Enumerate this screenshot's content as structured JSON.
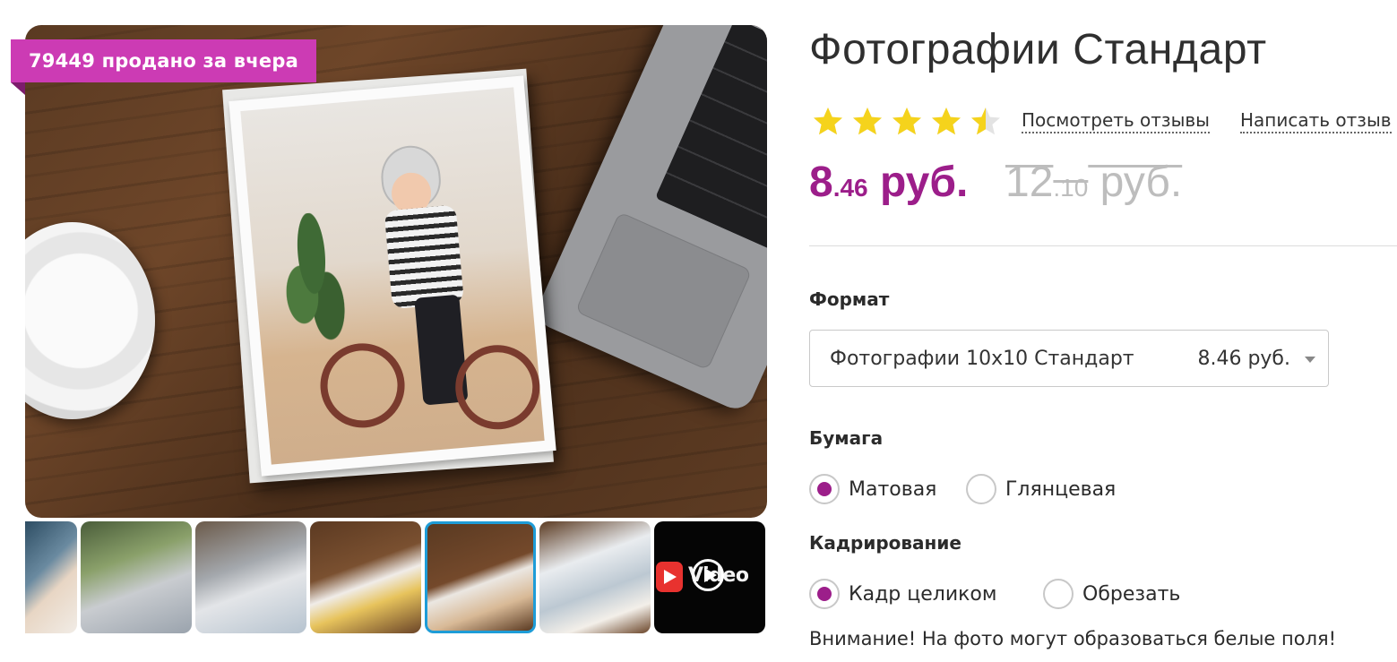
{
  "gallery": {
    "sold_badge": "79449 продано за вчера",
    "thumbnails": [
      {
        "name": "thumb-1"
      },
      {
        "name": "thumb-2"
      },
      {
        "name": "thumb-3"
      },
      {
        "name": "thumb-4"
      },
      {
        "name": "thumb-5",
        "selected": true
      },
      {
        "name": "thumb-6"
      },
      {
        "name": "thumb-video",
        "label": "Video"
      }
    ],
    "video_label": "Video"
  },
  "product": {
    "title": "Фотографии Стандарт",
    "rating": 4.5,
    "rating_max": 5,
    "view_reviews": "Посмотреть отзывы",
    "write_review": "Написать отзыв",
    "price_main": "8",
    "price_cents": ".46",
    "price_currency": " руб.",
    "old_price_main": "12",
    "old_price_cents": ".10",
    "old_price_currency": " руб."
  },
  "format": {
    "label": "Формат",
    "selected_name": "Фотографии 10x10 Стандарт",
    "selected_price": "8.46 руб."
  },
  "paper": {
    "label": "Бумага",
    "options": [
      "Матовая",
      "Глянцевая"
    ],
    "selected_index": 0
  },
  "crop": {
    "label": "Кадрирование",
    "options": [
      "Кадр целиком",
      "Обрезать"
    ],
    "selected_index": 0
  },
  "warning": "Внимание! На фото могут образоваться белые поля!",
  "colors": {
    "accent": "#9c1e8a",
    "badge": "#cc3bb4",
    "star": "#f5d31c",
    "selected_thumb_border": "#1e9cd7"
  },
  "icons": [
    "star-icon",
    "play-icon",
    "video-logo-icon",
    "dropdown-caret-icon"
  ]
}
